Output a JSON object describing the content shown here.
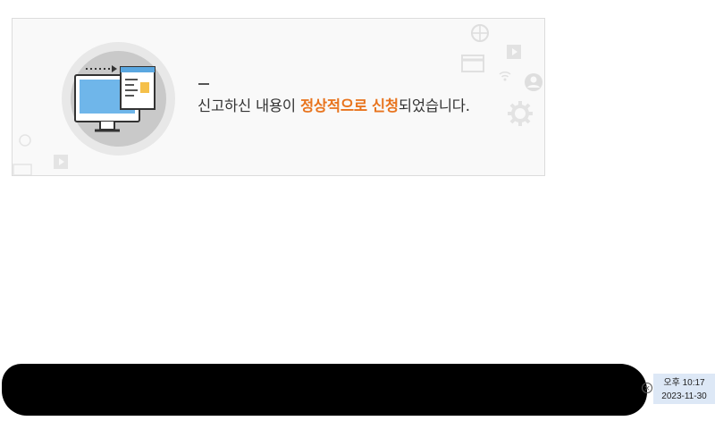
{
  "notice": {
    "message_part1": "신고하신 내용이 ",
    "message_highlight1": "정상적으로",
    "message_space": " ",
    "message_highlight2": "신청",
    "message_part2": "되었습니다.",
    "highlight_color": "#e8741e"
  },
  "taskbar": {
    "time": "오후 10:17",
    "date": "2023-11-30",
    "close_symbol": "×"
  },
  "icons": [
    "monitor-document-icon",
    "play-icon",
    "globe-icon",
    "user-icon",
    "gear-icon",
    "wifi-icon",
    "card-icon"
  ]
}
